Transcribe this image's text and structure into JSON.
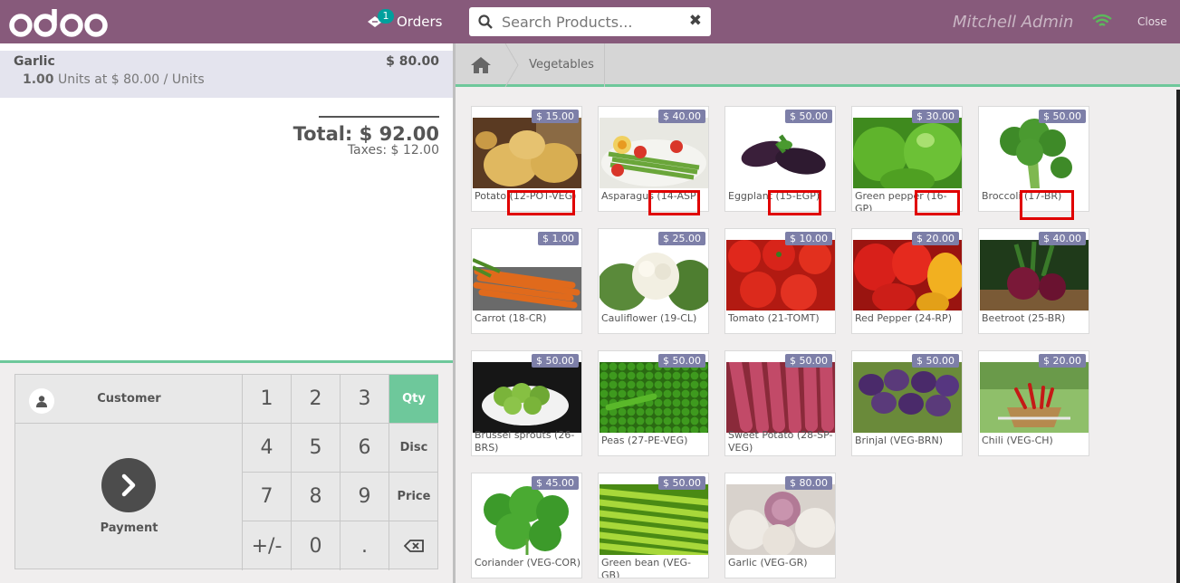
{
  "header": {
    "orders_label": "Orders",
    "orders_count": "1",
    "search_placeholder": "Search Products...",
    "user": "Mitchell Admin",
    "close_label": "Close",
    "accent": "#875a7b"
  },
  "order": {
    "line": {
      "name": "Garlic",
      "price": "$ 80.00",
      "qty": "1.00",
      "detail": "Units at $ 80.00 / Units"
    },
    "total": "Total: $ 92.00",
    "taxes": "Taxes: $ 12.00"
  },
  "controls": {
    "customer_label": "Customer",
    "payment_label": "Payment",
    "keys": [
      "1",
      "2",
      "3",
      "4",
      "5",
      "6",
      "7",
      "8",
      "9",
      "+/-",
      "0",
      "."
    ],
    "modes": [
      "Qty",
      "Disc",
      "Price"
    ],
    "active_mode": "Qty"
  },
  "breadcrumb": {
    "home_icon": "home-icon",
    "category": "Vegetables"
  },
  "products": [
    {
      "name": "Potato (12-POT-VEG)",
      "price": "$ 15.00"
    },
    {
      "name": "Asparagus (14-ASP)",
      "price": "$ 40.00"
    },
    {
      "name": "Eggplant (15-EGP)",
      "price": "$ 50.00"
    },
    {
      "name": "Green pepper (16-GP)",
      "price": "$ 30.00"
    },
    {
      "name": "Broccoli (17-BR)",
      "price": "$ 50.00"
    },
    {
      "name": "Carrot (18-CR)",
      "price": "$ 1.00"
    },
    {
      "name": "Cauliflower (19-CL)",
      "price": "$ 25.00"
    },
    {
      "name": "Tomato (21-TOMT)",
      "price": "$ 10.00"
    },
    {
      "name": "Red Pepper (24-RP)",
      "price": "$ 20.00"
    },
    {
      "name": "Beetroot (25-BR)",
      "price": "$ 40.00"
    },
    {
      "name": "Brussel sprouts (26-BRS)",
      "price": "$ 50.00"
    },
    {
      "name": "Peas (27-PE-VEG)",
      "price": "$ 50.00"
    },
    {
      "name": "Sweet Potato (28-SP-VEG)",
      "price": "$ 50.00"
    },
    {
      "name": "Brinjal (VEG-BRN)",
      "price": "$ 50.00"
    },
    {
      "name": "Chili (VEG-CH)",
      "price": "$ 20.00"
    },
    {
      "name": "Coriander (VEG-COR)",
      "price": "$ 45.00"
    },
    {
      "name": "Green bean (VEG-GB)",
      "price": "$ 50.00"
    },
    {
      "name": "Garlic (VEG-GR)",
      "price": "$ 80.00"
    }
  ]
}
